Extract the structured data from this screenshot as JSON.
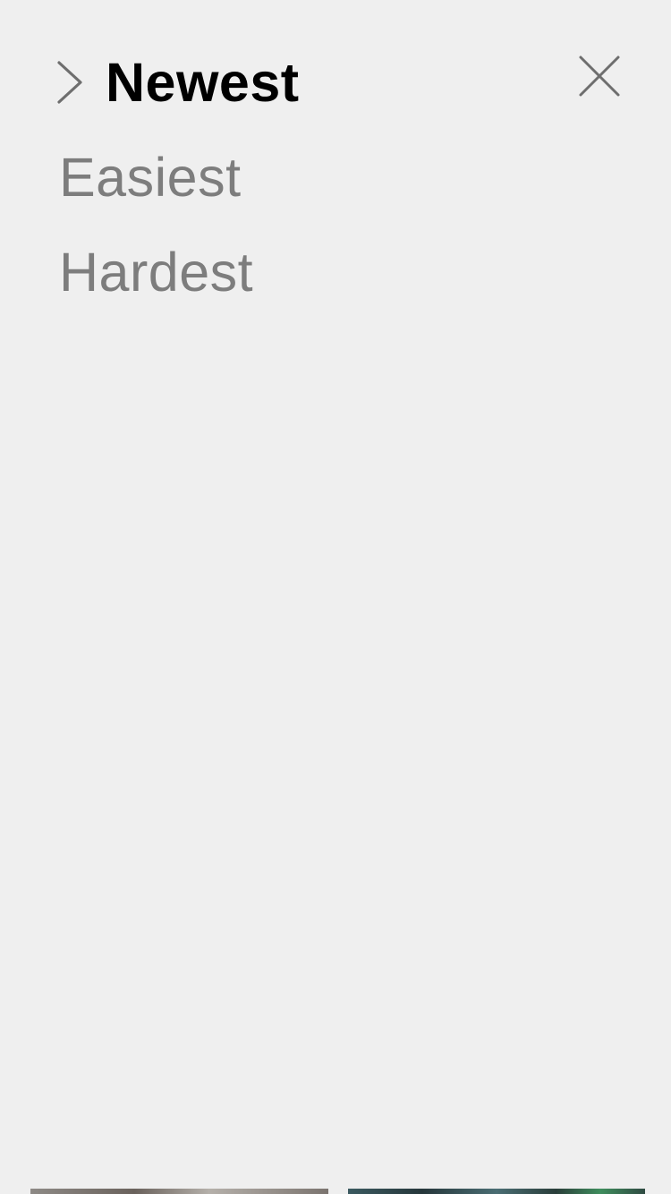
{
  "sort_menu": {
    "options": [
      {
        "label": "Newest",
        "selected": true
      },
      {
        "label": "Easiest",
        "selected": false
      },
      {
        "label": "Hardest",
        "selected": false
      }
    ],
    "selected_icon": "chevron-right-icon",
    "close_icon": "close-icon"
  },
  "colors": {
    "background": "#efefef",
    "selected_text": "#000000",
    "unselected_text": "#7d7d7d",
    "icon": "#6e6e6e"
  }
}
